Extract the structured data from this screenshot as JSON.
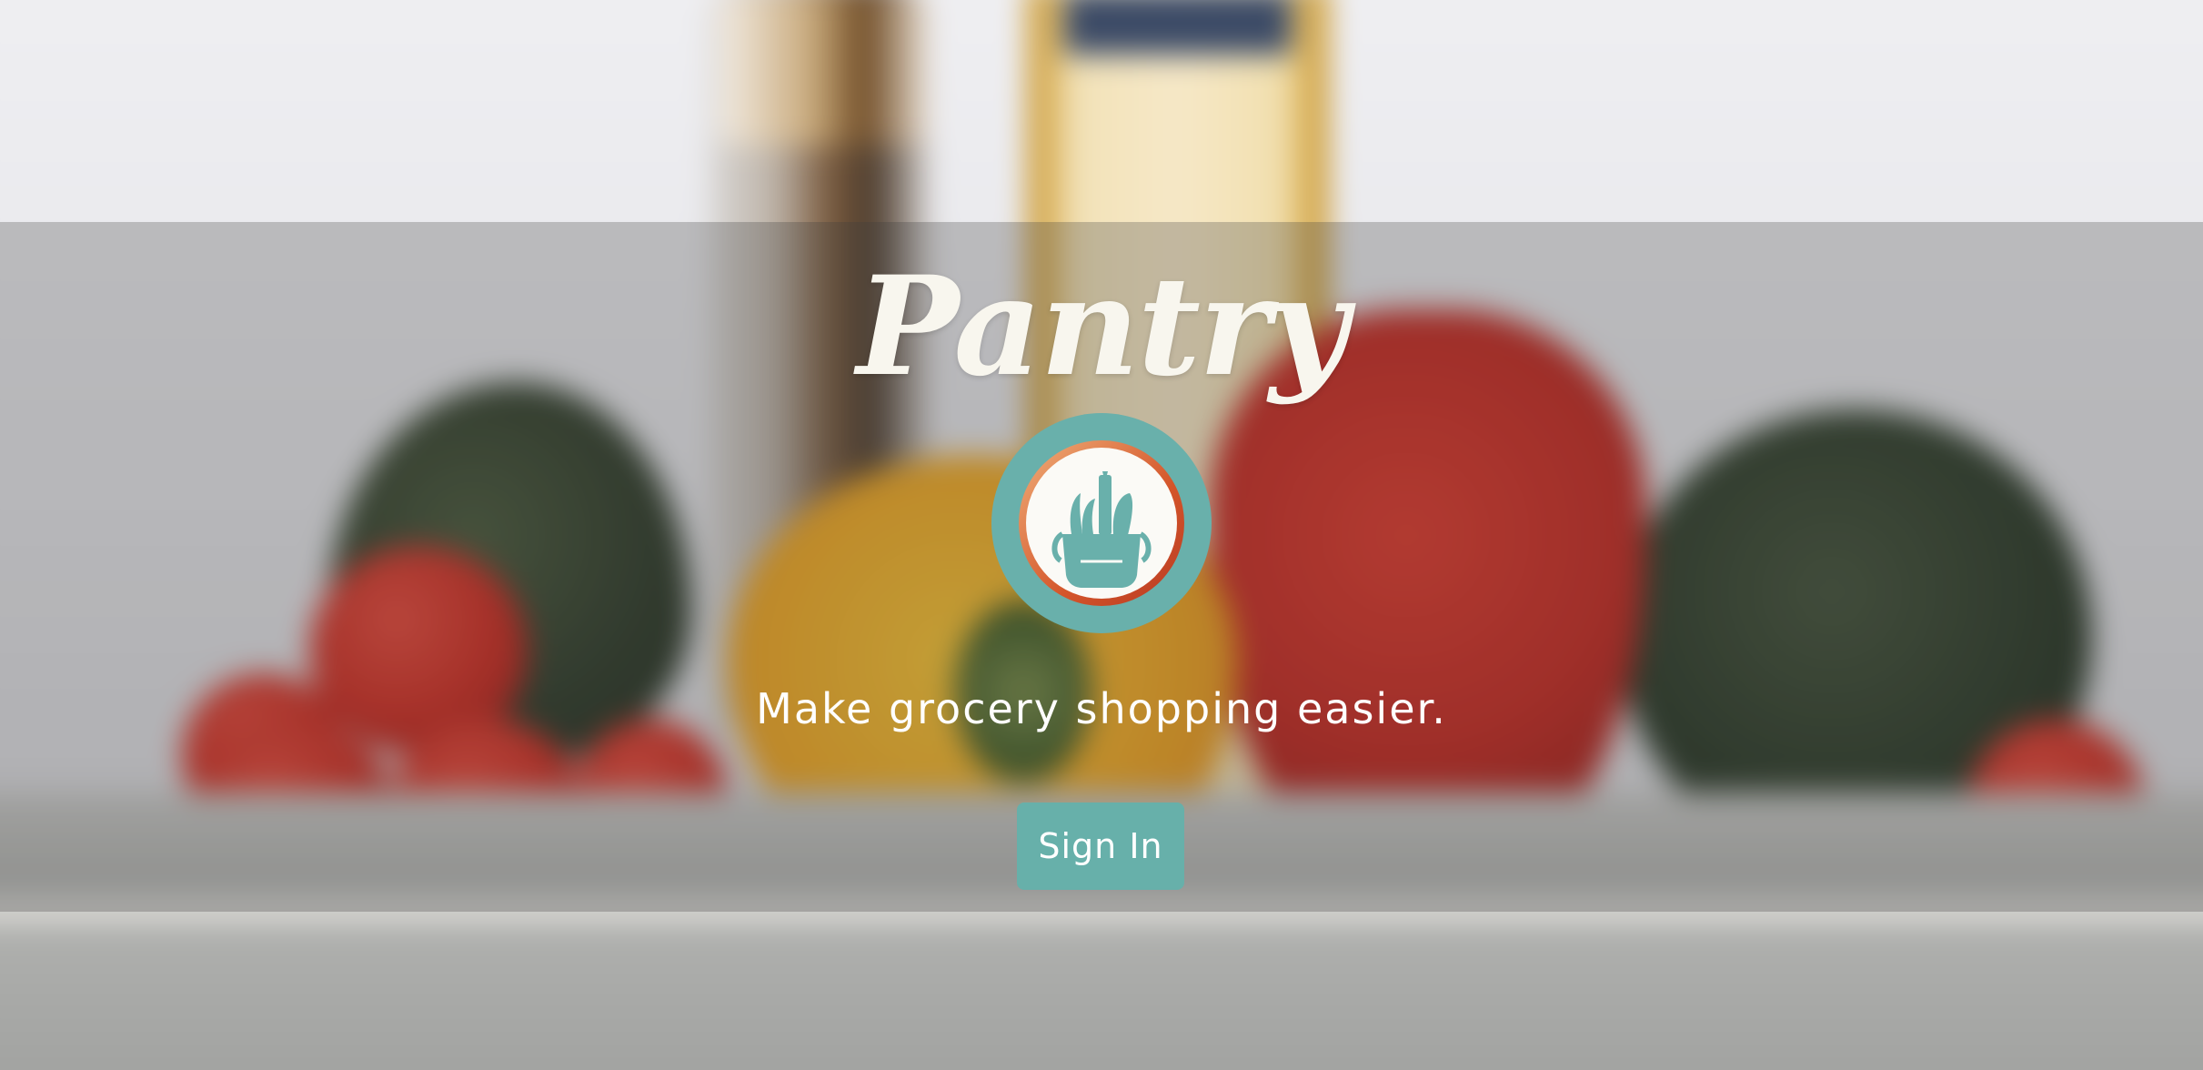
{
  "hero": {
    "brand": "Pantry",
    "tagline": "Make grocery shopping easier.",
    "signin_label": "Sign In"
  },
  "logo": {
    "icon": "grocery-bag-icon",
    "outer_color": "#69b0ab",
    "ring_color": "#d4552a",
    "bag_color": "#69b0ab"
  },
  "colors": {
    "accent": "#67b0aa",
    "text": "#ffffff"
  }
}
